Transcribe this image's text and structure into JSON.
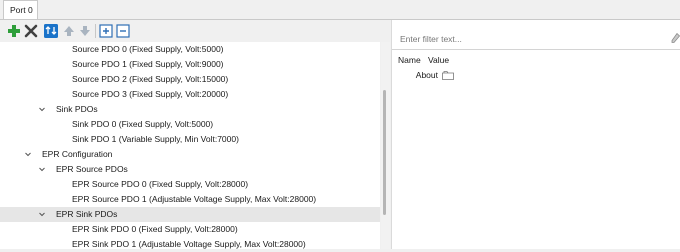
{
  "tabs": [
    {
      "label": "Port 0"
    }
  ],
  "toolbar": {
    "items": [
      {
        "icon": "add-icon"
      },
      {
        "icon": "remove-icon"
      },
      {
        "icon": "sort-icon"
      },
      {
        "icon": "move-up-icon"
      },
      {
        "icon": "move-down-icon"
      },
      {
        "icon": "expand-all-icon"
      },
      {
        "icon": "collapse-all-icon"
      }
    ]
  },
  "tree": {
    "rows": [
      {
        "label": "Source PDO 0 (Fixed Supply, Volt:5000)",
        "level": 3
      },
      {
        "label": "Source PDO 1 (Fixed Supply, Volt:9000)",
        "level": 3
      },
      {
        "label": "Source PDO 2 (Fixed Supply, Volt:15000)",
        "level": 3
      },
      {
        "label": "Source PDO 3 (Fixed Supply, Volt:20000)",
        "level": 3
      },
      {
        "label": "Sink PDOs",
        "level": 2,
        "expanded": true
      },
      {
        "label": "Sink PDO 0 (Fixed Supply, Volt:5000)",
        "level": 3
      },
      {
        "label": "Sink PDO 1 (Variable Supply, Min Volt:7000)",
        "level": 3
      },
      {
        "label": "EPR Configuration",
        "level": 1,
        "expanded": true
      },
      {
        "label": "EPR Source PDOs",
        "level": 2,
        "expanded": true
      },
      {
        "label": "EPR Source PDO 0 (Fixed Supply, Volt:28000)",
        "level": 3
      },
      {
        "label": "EPR Source PDO 1 (Adjustable Voltage Supply, Max Volt:28000)",
        "level": 3
      },
      {
        "label": "EPR Sink PDOs",
        "level": 2,
        "expanded": true,
        "selected": true
      },
      {
        "label": "EPR Sink PDO 0 (Fixed Supply, Volt:28000)",
        "level": 3
      },
      {
        "label": "EPR Sink PDO 1 (Adjustable Voltage Supply, Max Volt:28000)",
        "level": 3
      }
    ]
  },
  "properties": {
    "filter": {
      "placeholder": "Enter filter text...",
      "value": ""
    },
    "columns": {
      "name": "Name",
      "value": "Value"
    },
    "rows": [
      {
        "name": "About",
        "icon": "folder-icon"
      }
    ]
  },
  "colors": {
    "add": "#2e9e3a",
    "remove": "#404040",
    "sort": "#1a73c9",
    "arrows": "#9aa7b5",
    "expand": "#2f6fb5",
    "selected_row": "#e6e6e6"
  }
}
